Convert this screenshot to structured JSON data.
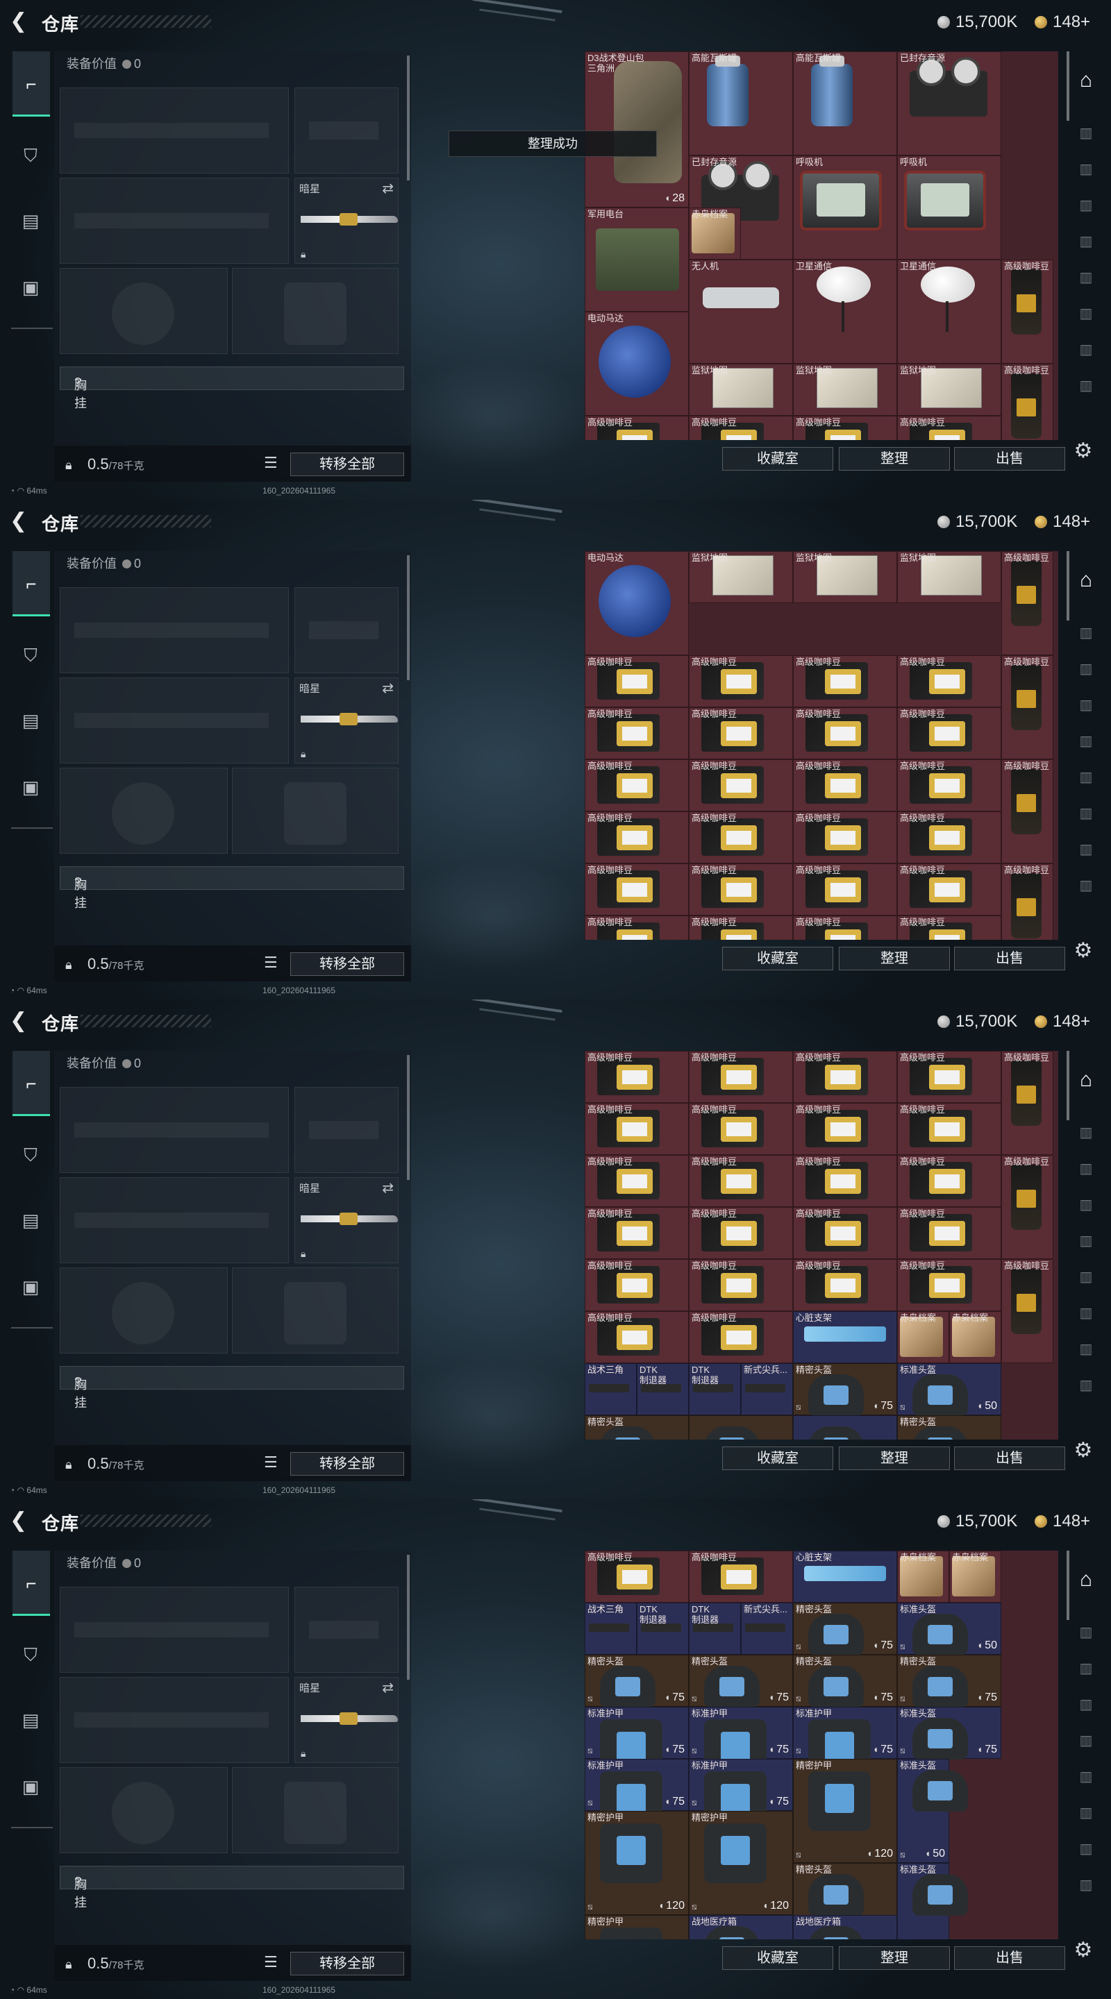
{
  "header": {
    "title": "仓库",
    "silver": "15,700K",
    "gold": "148+"
  },
  "equipment": {
    "value_label": "装备价值",
    "value": "0",
    "secondary_slot_label": "暗星",
    "chest_label": "胸挂",
    "chest_help": "?"
  },
  "footer": {
    "weight": "0.5",
    "capacity": "/78千克",
    "transfer_label": "转移全部"
  },
  "toolbar": {
    "collection": "收藏室",
    "organize": "整理",
    "sell": "出售"
  },
  "toast": "整理成功",
  "status": [
    "64ms",
    "64ms",
    "64ms",
    "64ms"
  ],
  "build": "160_202604111965",
  "screens": [
    {
      "cells": [
        {
          "c": 0,
          "r": 0,
          "w": 2,
          "h": 3,
          "label": "D3战术登山包\n三角洲",
          "art": "bag",
          "badge": "28"
        },
        {
          "c": 2,
          "r": 0,
          "w": 2,
          "h": 2,
          "label": "高能瓦斯罐",
          "art": "tank"
        },
        {
          "c": 4,
          "r": 0,
          "w": 2,
          "h": 2,
          "label": "高能瓦斯罐",
          "art": "tank"
        },
        {
          "c": 6,
          "r": 0,
          "w": 2,
          "h": 2,
          "label": "已封存音源",
          "art": "reel"
        },
        {
          "c": 2,
          "r": 2,
          "w": 2,
          "h": 2,
          "label": "已封存音源",
          "art": "reel"
        },
        {
          "c": 4,
          "r": 2,
          "w": 2,
          "h": 2,
          "label": "呼吸机",
          "art": "breath"
        },
        {
          "c": 6,
          "r": 2,
          "w": 2,
          "h": 2,
          "label": "呼吸机",
          "art": "breath"
        },
        {
          "c": 0,
          "r": 3,
          "w": 2,
          "h": 2,
          "label": "军用电台",
          "art": "radio"
        },
        {
          "c": 2,
          "r": 3,
          "w": 1,
          "h": 1,
          "label": "赤枭档案",
          "art": "file"
        },
        {
          "c": 2,
          "r": 4,
          "w": 2,
          "h": 2,
          "label": "无人机",
          "art": "drone"
        },
        {
          "c": 4,
          "r": 4,
          "w": 2,
          "h": 2,
          "label": "卫星通信",
          "art": "dish"
        },
        {
          "c": 6,
          "r": 4,
          "w": 2,
          "h": 2,
          "label": "卫星通信",
          "art": "dish"
        },
        {
          "c": 8,
          "r": 4,
          "w": 1,
          "h": 2,
          "label": "高级咖啡豆",
          "art": "coffee"
        },
        {
          "c": 0,
          "r": 5,
          "w": 2,
          "h": 2,
          "label": "电动马达",
          "art": "motor"
        },
        {
          "c": 2,
          "r": 6,
          "w": 2,
          "h": 1,
          "label": "监狱地图",
          "art": "map"
        },
        {
          "c": 4,
          "r": 6,
          "w": 2,
          "h": 1,
          "label": "监狱地图",
          "art": "map"
        },
        {
          "c": 6,
          "r": 6,
          "w": 2,
          "h": 1,
          "label": "监狱地图",
          "art": "map"
        },
        {
          "c": 8,
          "r": 6,
          "w": 1,
          "h": 2,
          "label": "高级咖啡豆",
          "art": "coffee"
        },
        {
          "c": 0,
          "r": 7,
          "w": 2,
          "h": 1,
          "label": "高级咖啡豆",
          "art": "cbox"
        },
        {
          "c": 2,
          "r": 7,
          "w": 2,
          "h": 1,
          "label": "高级咖啡豆",
          "art": "cbox"
        },
        {
          "c": 4,
          "r": 7,
          "w": 2,
          "h": 1,
          "label": "高级咖啡豆",
          "art": "cbox"
        },
        {
          "c": 6,
          "r": 7,
          "w": 2,
          "h": 1,
          "label": "高级咖啡豆",
          "art": "cbox"
        }
      ]
    },
    {
      "cells": [
        {
          "c": 0,
          "r": 0,
          "w": 2,
          "h": 2,
          "label": "电动马达",
          "art": "motor"
        },
        {
          "c": 2,
          "r": 0,
          "w": 2,
          "h": 1,
          "label": "监狱地图",
          "art": "map"
        },
        {
          "c": 4,
          "r": 0,
          "w": 2,
          "h": 1,
          "label": "监狱地图",
          "art": "map"
        },
        {
          "c": 6,
          "r": 0,
          "w": 2,
          "h": 1,
          "label": "监狱地图",
          "art": "map"
        },
        {
          "c": 8,
          "r": 0,
          "w": 1,
          "h": 2,
          "label": "高级咖啡豆",
          "art": "coffee"
        },
        {
          "c": 0,
          "r": 2,
          "w": 2,
          "h": 1,
          "label": "高级咖啡豆",
          "art": "cbox"
        },
        {
          "c": 2,
          "r": 2,
          "w": 2,
          "h": 1,
          "label": "高级咖啡豆",
          "art": "cbox"
        },
        {
          "c": 4,
          "r": 2,
          "w": 2,
          "h": 1,
          "label": "高级咖啡豆",
          "art": "cbox"
        },
        {
          "c": 6,
          "r": 2,
          "w": 2,
          "h": 1,
          "label": "高级咖啡豆",
          "art": "cbox"
        },
        {
          "c": 8,
          "r": 2,
          "w": 1,
          "h": 2,
          "label": "高级咖啡豆",
          "art": "coffee"
        },
        {
          "c": 0,
          "r": 3,
          "w": 2,
          "h": 1,
          "label": "高级咖啡豆",
          "art": "cbox"
        },
        {
          "c": 2,
          "r": 3,
          "w": 2,
          "h": 1,
          "label": "高级咖啡豆",
          "art": "cbox"
        },
        {
          "c": 4,
          "r": 3,
          "w": 2,
          "h": 1,
          "label": "高级咖啡豆",
          "art": "cbox"
        },
        {
          "c": 6,
          "r": 3,
          "w": 2,
          "h": 1,
          "label": "高级咖啡豆",
          "art": "cbox"
        },
        {
          "c": 0,
          "r": 4,
          "w": 2,
          "h": 1,
          "label": "高级咖啡豆",
          "art": "cbox"
        },
        {
          "c": 2,
          "r": 4,
          "w": 2,
          "h": 1,
          "label": "高级咖啡豆",
          "art": "cbox"
        },
        {
          "c": 4,
          "r": 4,
          "w": 2,
          "h": 1,
          "label": "高级咖啡豆",
          "art": "cbox"
        },
        {
          "c": 6,
          "r": 4,
          "w": 2,
          "h": 1,
          "label": "高级咖啡豆",
          "art": "cbox"
        },
        {
          "c": 8,
          "r": 4,
          "w": 1,
          "h": 2,
          "label": "高级咖啡豆",
          "art": "coffee"
        },
        {
          "c": 0,
          "r": 5,
          "w": 2,
          "h": 1,
          "label": "高级咖啡豆",
          "art": "cbox"
        },
        {
          "c": 2,
          "r": 5,
          "w": 2,
          "h": 1,
          "label": "高级咖啡豆",
          "art": "cbox"
        },
        {
          "c": 4,
          "r": 5,
          "w": 2,
          "h": 1,
          "label": "高级咖啡豆",
          "art": "cbox"
        },
        {
          "c": 6,
          "r": 5,
          "w": 2,
          "h": 1,
          "label": "高级咖啡豆",
          "art": "cbox"
        },
        {
          "c": 0,
          "r": 6,
          "w": 2,
          "h": 1,
          "label": "高级咖啡豆",
          "art": "cbox"
        },
        {
          "c": 2,
          "r": 6,
          "w": 2,
          "h": 1,
          "label": "高级咖啡豆",
          "art": "cbox"
        },
        {
          "c": 4,
          "r": 6,
          "w": 2,
          "h": 1,
          "label": "高级咖啡豆",
          "art": "cbox"
        },
        {
          "c": 6,
          "r": 6,
          "w": 2,
          "h": 1,
          "label": "高级咖啡豆",
          "art": "cbox"
        },
        {
          "c": 8,
          "r": 6,
          "w": 1,
          "h": 2,
          "label": "高级咖啡豆",
          "art": "coffee"
        },
        {
          "c": 0,
          "r": 7,
          "w": 2,
          "h": 1,
          "label": "高级咖啡豆",
          "art": "cbox"
        },
        {
          "c": 2,
          "r": 7,
          "w": 2,
          "h": 1,
          "label": "高级咖啡豆",
          "art": "cbox"
        },
        {
          "c": 4,
          "r": 7,
          "w": 2,
          "h": 1,
          "label": "高级咖啡豆",
          "art": "cbox"
        },
        {
          "c": 6,
          "r": 7,
          "w": 2,
          "h": 1,
          "label": "高级咖啡豆",
          "art": "cbox"
        }
      ]
    },
    {
      "cells": [
        {
          "c": 0,
          "r": 0,
          "w": 2,
          "h": 1,
          "label": "高级咖啡豆",
          "art": "cbox"
        },
        {
          "c": 2,
          "r": 0,
          "w": 2,
          "h": 1,
          "label": "高级咖啡豆",
          "art": "cbox"
        },
        {
          "c": 4,
          "r": 0,
          "w": 2,
          "h": 1,
          "label": "高级咖啡豆",
          "art": "cbox"
        },
        {
          "c": 6,
          "r": 0,
          "w": 2,
          "h": 1,
          "label": "高级咖啡豆",
          "art": "cbox"
        },
        {
          "c": 8,
          "r": 0,
          "w": 1,
          "h": 2,
          "label": "高级咖啡豆",
          "art": "coffee"
        },
        {
          "c": 0,
          "r": 1,
          "w": 2,
          "h": 1,
          "label": "高级咖啡豆",
          "art": "cbox"
        },
        {
          "c": 2,
          "r": 1,
          "w": 2,
          "h": 1,
          "label": "高级咖啡豆",
          "art": "cbox"
        },
        {
          "c": 4,
          "r": 1,
          "w": 2,
          "h": 1,
          "label": "高级咖啡豆",
          "art": "cbox"
        },
        {
          "c": 6,
          "r": 1,
          "w": 2,
          "h": 1,
          "label": "高级咖啡豆",
          "art": "cbox"
        },
        {
          "c": 0,
          "r": 2,
          "w": 2,
          "h": 1,
          "label": "高级咖啡豆",
          "art": "cbox"
        },
        {
          "c": 2,
          "r": 2,
          "w": 2,
          "h": 1,
          "label": "高级咖啡豆",
          "art": "cbox"
        },
        {
          "c": 4,
          "r": 2,
          "w": 2,
          "h": 1,
          "label": "高级咖啡豆",
          "art": "cbox"
        },
        {
          "c": 6,
          "r": 2,
          "w": 2,
          "h": 1,
          "label": "高级咖啡豆",
          "art": "cbox"
        },
        {
          "c": 8,
          "r": 2,
          "w": 1,
          "h": 2,
          "label": "高级咖啡豆",
          "art": "coffee"
        },
        {
          "c": 0,
          "r": 3,
          "w": 2,
          "h": 1,
          "label": "高级咖啡豆",
          "art": "cbox"
        },
        {
          "c": 2,
          "r": 3,
          "w": 2,
          "h": 1,
          "label": "高级咖啡豆",
          "art": "cbox"
        },
        {
          "c": 4,
          "r": 3,
          "w": 2,
          "h": 1,
          "label": "高级咖啡豆",
          "art": "cbox"
        },
        {
          "c": 6,
          "r": 3,
          "w": 2,
          "h": 1,
          "label": "高级咖啡豆",
          "art": "cbox"
        },
        {
          "c": 0,
          "r": 4,
          "w": 2,
          "h": 1,
          "label": "高级咖啡豆",
          "art": "cbox"
        },
        {
          "c": 2,
          "r": 4,
          "w": 2,
          "h": 1,
          "label": "高级咖啡豆",
          "art": "cbox"
        },
        {
          "c": 4,
          "r": 4,
          "w": 2,
          "h": 1,
          "label": "高级咖啡豆",
          "art": "cbox"
        },
        {
          "c": 6,
          "r": 4,
          "w": 2,
          "h": 1,
          "label": "高级咖啡豆",
          "art": "cbox"
        },
        {
          "c": 8,
          "r": 4,
          "w": 1,
          "h": 2,
          "label": "高级咖啡豆",
          "art": "coffee"
        },
        {
          "c": 0,
          "r": 5,
          "w": 2,
          "h": 1,
          "label": "高级咖啡豆",
          "art": "cbox"
        },
        {
          "c": 2,
          "r": 5,
          "w": 2,
          "h": 1,
          "label": "高级咖啡豆",
          "art": "cbox"
        },
        {
          "c": 4,
          "r": 5,
          "w": 2,
          "h": 1,
          "label": "心脏支架",
          "art": "stim",
          "tone": "blue"
        },
        {
          "c": 6,
          "r": 5,
          "w": 1,
          "h": 1,
          "label": "赤枭档案",
          "art": "file"
        },
        {
          "c": 7,
          "r": 5,
          "w": 1,
          "h": 1,
          "label": "赤枭档案",
          "art": "file"
        },
        {
          "c": 0,
          "r": 6,
          "w": 1,
          "h": 1,
          "label": "战术三角",
          "art": "gun",
          "tone": "blue"
        },
        {
          "c": 1,
          "r": 6,
          "w": 1,
          "h": 1,
          "label": "DTK\n制退器",
          "art": "gun",
          "tone": "blue"
        },
        {
          "c": 2,
          "r": 6,
          "w": 1,
          "h": 1,
          "label": "DTK\n制退器",
          "art": "gun",
          "tone": "blue"
        },
        {
          "c": 3,
          "r": 6,
          "w": 1,
          "h": 1,
          "label": "新式尖兵...",
          "art": "gun",
          "tone": "blue"
        },
        {
          "c": 4,
          "r": 6,
          "w": 2,
          "h": 1,
          "label": "精密头盔",
          "art": "helmet",
          "tone": "brown",
          "dur": "75"
        },
        {
          "c": 6,
          "r": 6,
          "w": 2,
          "h": 1,
          "label": "标准头盔",
          "art": "helmet",
          "tone": "blue",
          "dur": "50"
        },
        {
          "c": 0,
          "r": 7,
          "w": 2,
          "h": 1,
          "label": "精密头盔",
          "art": "helmet",
          "tone": "brown"
        },
        {
          "c": 2,
          "r": 7,
          "w": 2,
          "h": 1,
          "label": "",
          "art": "helmet",
          "tone": "brown"
        },
        {
          "c": 4,
          "r": 7,
          "w": 2,
          "h": 1,
          "label": "",
          "art": "helmet",
          "tone": "blue"
        },
        {
          "c": 6,
          "r": 7,
          "w": 2,
          "h": 1,
          "label": "精密头盔",
          "art": "helmet",
          "tone": "brown"
        }
      ]
    },
    {
      "cells": [
        {
          "c": 0,
          "r": 0,
          "w": 2,
          "h": 1,
          "label": "高级咖啡豆",
          "art": "cbox"
        },
        {
          "c": 2,
          "r": 0,
          "w": 2,
          "h": 1,
          "label": "高级咖啡豆",
          "art": "cbox"
        },
        {
          "c": 4,
          "r": 0,
          "w": 2,
          "h": 1,
          "label": "心脏支架",
          "art": "stim",
          "tone": "blue"
        },
        {
          "c": 6,
          "r": 0,
          "w": 1,
          "h": 1,
          "label": "赤枭档案",
          "art": "file"
        },
        {
          "c": 7,
          "r": 0,
          "w": 1,
          "h": 1,
          "label": "赤枭档案",
          "art": "file"
        },
        {
          "c": 0,
          "r": 1,
          "w": 1,
          "h": 1,
          "label": "战术三角",
          "art": "gun",
          "tone": "blue"
        },
        {
          "c": 1,
          "r": 1,
          "w": 1,
          "h": 1,
          "label": "DTK\n制退器",
          "art": "gun",
          "tone": "blue"
        },
        {
          "c": 2,
          "r": 1,
          "w": 1,
          "h": 1,
          "label": "DTK\n制退器",
          "art": "gun",
          "tone": "blue"
        },
        {
          "c": 3,
          "r": 1,
          "w": 1,
          "h": 1,
          "label": "新式尖兵...",
          "art": "gun",
          "tone": "blue"
        },
        {
          "c": 4,
          "r": 1,
          "w": 2,
          "h": 1,
          "label": "精密头盔",
          "art": "helmet",
          "tone": "brown",
          "dur": "75"
        },
        {
          "c": 6,
          "r": 1,
          "w": 2,
          "h": 1,
          "label": "标准头盔",
          "art": "helmet",
          "tone": "blue",
          "dur": "50"
        },
        {
          "c": 0,
          "r": 2,
          "w": 2,
          "h": 1,
          "label": "精密头盔",
          "art": "helmet",
          "tone": "brown",
          "dur": "75"
        },
        {
          "c": 2,
          "r": 2,
          "w": 2,
          "h": 1,
          "label": "精密头盔",
          "art": "helmet",
          "tone": "brown",
          "dur": "75"
        },
        {
          "c": 4,
          "r": 2,
          "w": 2,
          "h": 1,
          "label": "精密头盔",
          "art": "helmet",
          "tone": "brown",
          "dur": "75"
        },
        {
          "c": 6,
          "r": 2,
          "w": 2,
          "h": 1,
          "label": "精密头盔",
          "art": "helmet",
          "tone": "brown",
          "dur": "75"
        },
        {
          "c": 0,
          "r": 3,
          "w": 2,
          "h": 1,
          "label": "标准护甲",
          "art": "vest",
          "tone": "blue",
          "dur": "75"
        },
        {
          "c": 2,
          "r": 3,
          "w": 2,
          "h": 1,
          "label": "标准护甲",
          "art": "vest",
          "tone": "blue",
          "dur": "75"
        },
        {
          "c": 4,
          "r": 3,
          "w": 2,
          "h": 1,
          "label": "标准护甲",
          "art": "vest",
          "tone": "blue",
          "dur": "75"
        },
        {
          "c": 6,
          "r": 3,
          "w": 2,
          "h": 1,
          "label": "标准头盔",
          "art": "helmet",
          "tone": "blue",
          "dur": "75"
        },
        {
          "c": 0,
          "r": 4,
          "w": 2,
          "h": 1,
          "label": "标准护甲",
          "art": "vest",
          "tone": "blue",
          "dur": "75"
        },
        {
          "c": 2,
          "r": 4,
          "w": 2,
          "h": 1,
          "label": "标准护甲",
          "art": "vest",
          "tone": "blue",
          "dur": "75"
        },
        {
          "c": 4,
          "r": 4,
          "w": 2,
          "h": 2,
          "label": "精密护甲",
          "art": "vest",
          "tone": "brown",
          "dur": "120"
        },
        {
          "c": 6,
          "r": 4,
          "w": 1,
          "h": 2,
          "label": "标准头盔",
          "art": "helmet",
          "tone": "blue",
          "dur": "50"
        },
        {
          "c": 0,
          "r": 5,
          "w": 2,
          "h": 2,
          "label": "精密护甲",
          "art": "vest",
          "tone": "brown",
          "dur": "120"
        },
        {
          "c": 2,
          "r": 5,
          "w": 2,
          "h": 2,
          "label": "精密护甲",
          "art": "vest",
          "tone": "brown",
          "dur": "120"
        },
        {
          "c": 4,
          "r": 6,
          "w": 2,
          "h": 2,
          "label": "精密头盔",
          "art": "helmet",
          "tone": "brown"
        },
        {
          "c": 6,
          "r": 6,
          "w": 1,
          "h": 2,
          "label": "标准头盔",
          "art": "helmet",
          "tone": "blue"
        },
        {
          "c": 0,
          "r": 7,
          "w": 2,
          "h": 1,
          "label": "精密护甲",
          "art": "vest",
          "tone": "brown"
        },
        {
          "c": 2,
          "r": 7,
          "w": 2,
          "h": 1,
          "label": "战地医疗箱",
          "art": "helmet",
          "tone": "blue"
        },
        {
          "c": 4,
          "r": 7,
          "w": 2,
          "h": 1,
          "label": "战地医疗箱",
          "art": "helmet",
          "tone": "blue"
        }
      ]
    }
  ]
}
